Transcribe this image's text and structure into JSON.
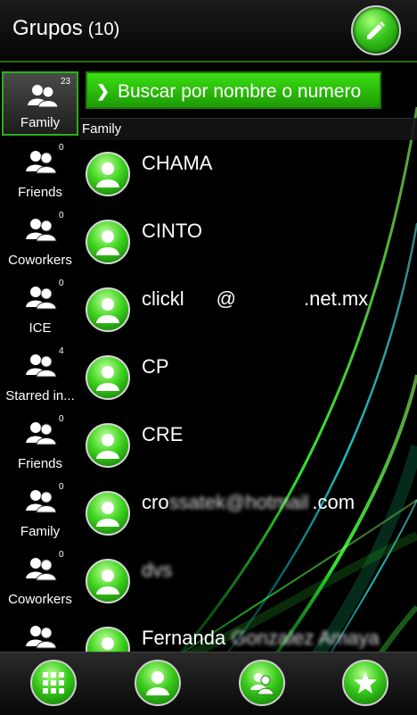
{
  "header": {
    "title": "Grupos",
    "count": "(10)"
  },
  "search": {
    "placeholder": "Buscar por nombre o numero"
  },
  "filter_label": "Family",
  "groups": [
    {
      "label": "Family",
      "count": "23"
    },
    {
      "label": "Friends",
      "count": "0"
    },
    {
      "label": "Coworkers",
      "count": "0"
    },
    {
      "label": "ICE",
      "count": "0"
    },
    {
      "label": "Starred in...",
      "count": "4"
    },
    {
      "label": "Friends",
      "count": "0"
    },
    {
      "label": "Family",
      "count": "0"
    },
    {
      "label": "Coworkers",
      "count": "0"
    }
  ],
  "contacts": [
    {
      "name": "CHAMA"
    },
    {
      "name": "CINTO"
    },
    {
      "name_parts": [
        "clickl",
        "@",
        ".net.mx"
      ]
    },
    {
      "name": "CP"
    },
    {
      "name": "CRE"
    },
    {
      "name_parts": [
        "cro",
        "ssatek@hotmail",
        ".com"
      ]
    },
    {
      "name": "dvs"
    },
    {
      "name_parts": [
        "Fernanda",
        "Gonzalez Amaya"
      ]
    }
  ],
  "colors": {
    "accent": "#2ecc12",
    "accent_dark": "#117306",
    "background": "#000000"
  },
  "icons": {
    "header_action": "pencil-icon",
    "group": "group-icon",
    "avatar": "person-icon",
    "bottom": [
      "dialpad-icon",
      "contacts-icon",
      "groups-icon",
      "star-icon"
    ]
  }
}
